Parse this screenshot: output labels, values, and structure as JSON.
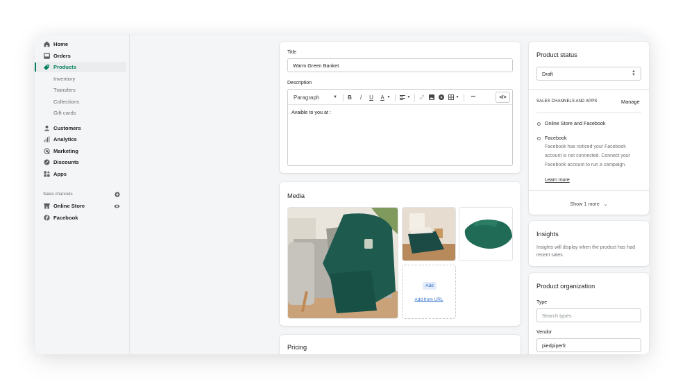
{
  "sidebar": {
    "items": [
      {
        "label": "Home",
        "icon": "home-icon"
      },
      {
        "label": "Orders",
        "icon": "inbox-icon"
      },
      {
        "label": "Products",
        "icon": "tag-icon",
        "active": true
      },
      {
        "label": "Inventory",
        "sub": true
      },
      {
        "label": "Transfers",
        "sub": true
      },
      {
        "label": "Collections",
        "sub": true
      },
      {
        "label": "Gift cards",
        "sub": true
      },
      {
        "label": "Customers",
        "icon": "person-icon"
      },
      {
        "label": "Analytics",
        "icon": "bar-chart-icon"
      },
      {
        "label": "Marketing",
        "icon": "target-icon"
      },
      {
        "label": "Discounts",
        "icon": "discount-icon"
      },
      {
        "label": "Apps",
        "icon": "apps-icon"
      }
    ],
    "sales_channels_label": "Sales channels",
    "channels": [
      {
        "label": "Online Store",
        "icon": "store-icon",
        "action_icon": "eye-icon"
      },
      {
        "label": "Facebook",
        "icon": "facebook-icon"
      }
    ]
  },
  "product": {
    "title_label": "Title",
    "title_value": "Warm Green Banket",
    "description_label": "Description",
    "editor": {
      "format_select": "Paragraph",
      "tools": [
        "bold-icon",
        "italic-icon",
        "underline-icon",
        "text-color-icon",
        "align-icon",
        "link-icon",
        "image-icon",
        "video-icon",
        "table-icon",
        "more-icon",
        "html-icon"
      ],
      "bold": "B",
      "italic": "I",
      "underline": "U",
      "color": "A",
      "more": "•••",
      "html": "</>",
      "body": "Avaible to you at :"
    }
  },
  "media": {
    "title": "Media",
    "images": [
      "Green blanket draped over grey sofa with cushion and mug",
      "Green blanket on bed in bedroom",
      "Folded green fleece blanket"
    ],
    "add_label": "Add",
    "add_from_url_label": "Add from URL"
  },
  "pricing": {
    "title": "Pricing"
  },
  "status": {
    "title": "Product status",
    "select_value": "Draft",
    "channels_heading": "SALES CHANNELS AND APPS",
    "manage_label": "Manage",
    "channels": [
      {
        "name": "Online Store and Facebook"
      },
      {
        "name": "Facebook",
        "note": "Facebook has noticed your Facebook account is not connected. Connect your Facebook account to run a campaign.",
        "link": "Learn more"
      }
    ],
    "show_more_label": "Show 1 more"
  },
  "insights": {
    "title": "Insights",
    "body": "Insights will display when the product has had recent sales"
  },
  "organization": {
    "title": "Product organization",
    "type_label": "Type",
    "type_placeholder": "Search types",
    "vendor_label": "Vendor",
    "vendor_value": "piedpiperfr"
  },
  "colors": {
    "accent": "#008060",
    "link": "#2c6ecb",
    "background": "#f4f5f7"
  }
}
